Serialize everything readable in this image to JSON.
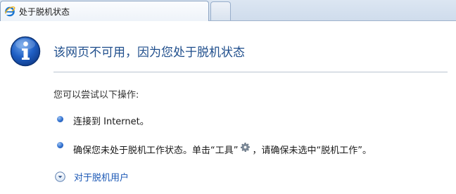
{
  "tab": {
    "title": "处于脱机状态",
    "favicon": "ie-icon"
  },
  "main": {
    "heading": "该网页不可用，因为您处于脱机状态",
    "subtitle": "您可以尝试以下操作:",
    "steps": [
      {
        "text": "连接到 Internet。"
      },
      {
        "prefix": "确保您未处于脱机工作状态。单击“工具”",
        "icon": "gear-icon",
        "suffix": "，请确保未选中“脱机工作”。"
      }
    ],
    "expander_label": "对于脱机用户"
  },
  "colors": {
    "heading": "#1f4e8c",
    "link": "#1a57b5",
    "bullet": "#2f6fcf"
  }
}
